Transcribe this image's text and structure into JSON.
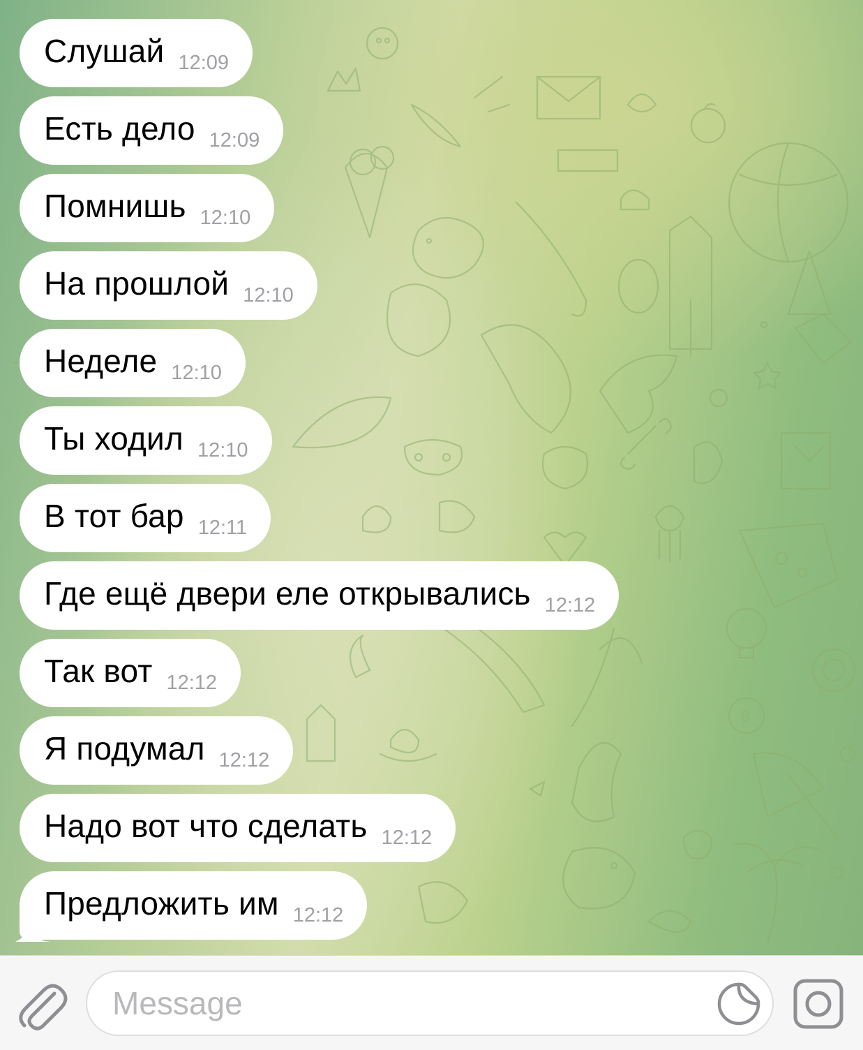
{
  "chat": {
    "messages": [
      {
        "text": "Слушай",
        "time": "12:09"
      },
      {
        "text": "Есть дело",
        "time": "12:09"
      },
      {
        "text": "Помнишь",
        "time": "12:10"
      },
      {
        "text": "На прошлой",
        "time": "12:10"
      },
      {
        "text": "Неделе",
        "time": "12:10"
      },
      {
        "text": "Ты ходил",
        "time": "12:10"
      },
      {
        "text": "В тот бар",
        "time": "12:11"
      },
      {
        "text": "Где ещё двери еле открывались",
        "time": "12:12"
      },
      {
        "text": "Так вот",
        "time": "12:12"
      },
      {
        "text": "Я подумал",
        "time": "12:12"
      },
      {
        "text": "Надо вот что сделать",
        "time": "12:12"
      },
      {
        "text": "Предложить им",
        "time": "12:12"
      }
    ]
  },
  "composer": {
    "placeholder": "Message",
    "value": "",
    "icons": {
      "attach": "paperclip-icon",
      "sticker": "sticker-icon",
      "camera": "camera-icon"
    },
    "icon_color": "#8e8e93"
  },
  "theme": {
    "bubble_color": "#ffffff",
    "time_color": "#a0a0a5",
    "wallpaper_colors": [
      "#7fb287",
      "#d2dcab",
      "#86b47b"
    ]
  }
}
